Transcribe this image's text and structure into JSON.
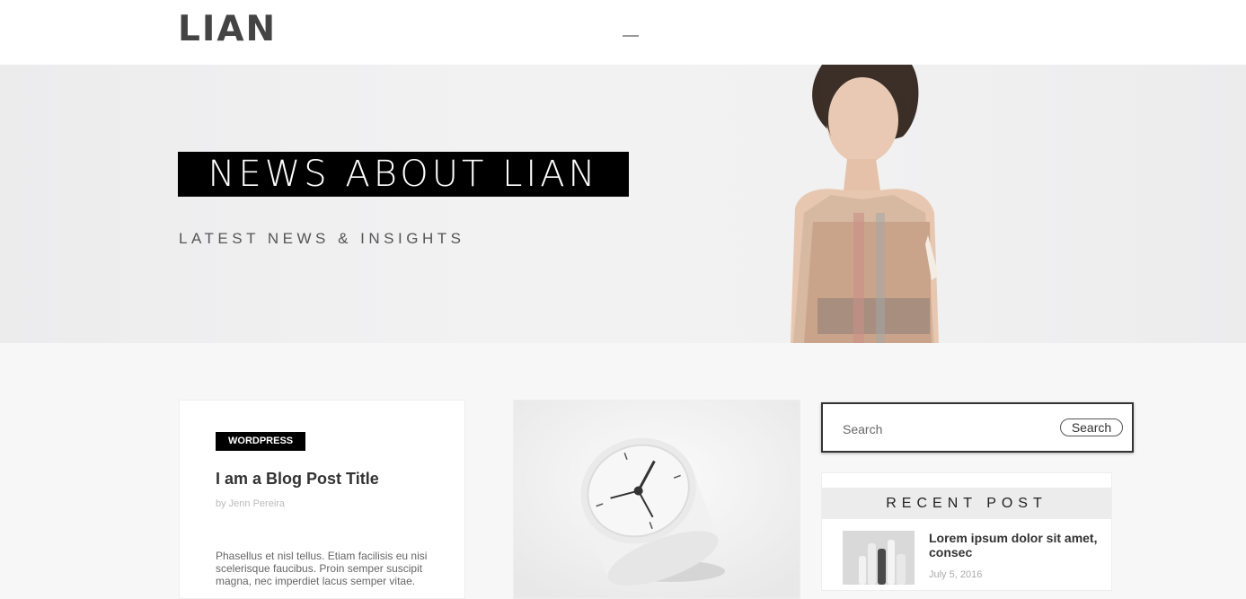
{
  "header": {
    "logo": "LIAN"
  },
  "hero": {
    "title": "NEWS ABOUT LIAN",
    "subtitle": "LATEST NEWS & INSIGHTS"
  },
  "post": {
    "category": "WORDPRESS",
    "title": "I am a Blog Post Title",
    "author": "by Jenn Pereira",
    "excerpt": "Phasellus et nisl tellus. Etiam facilisis eu nisi scelerisque faucibus. Proin semper suscipit magna, nec imperdiet lacus semper vitae."
  },
  "search": {
    "placeholder": "Search",
    "button_label": "Search"
  },
  "recent": {
    "heading": "RECENT POST",
    "items": [
      {
        "title": "Lorem ipsum dolor sit amet, consec",
        "date": "July 5, 2016"
      }
    ]
  }
}
